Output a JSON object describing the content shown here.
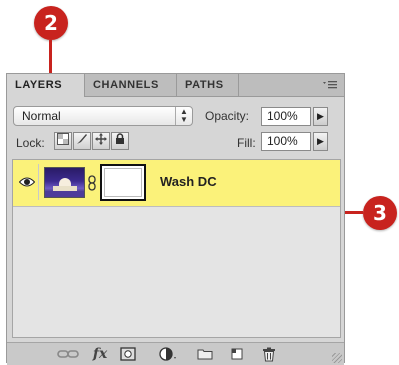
{
  "callouts": [
    "2",
    "3"
  ],
  "panel": {
    "tabs": [
      {
        "label": "LAYERS",
        "active": true
      },
      {
        "label": "CHANNELS",
        "active": false
      },
      {
        "label": "PATHS",
        "active": false
      }
    ],
    "menu_icon": "panel-menu-icon",
    "blend_mode": "Normal",
    "opacity_label": "Opacity:",
    "opacity_value": "100%",
    "lock_label": "Lock:",
    "fill_label": "Fill:",
    "fill_value": "100%",
    "layers": [
      {
        "name": "Wash DC",
        "visible": true,
        "selected": true,
        "has_mask": true
      }
    ],
    "bottom_icons": [
      "link-layers-icon",
      "fx-icon",
      "add-mask-icon",
      "adjustment-layer-icon",
      "group-folder-icon",
      "new-layer-icon",
      "trash-icon"
    ],
    "fx_label": "fx"
  },
  "colors": {
    "callout": "#c8231e",
    "selected_layer": "#fbf27a"
  }
}
